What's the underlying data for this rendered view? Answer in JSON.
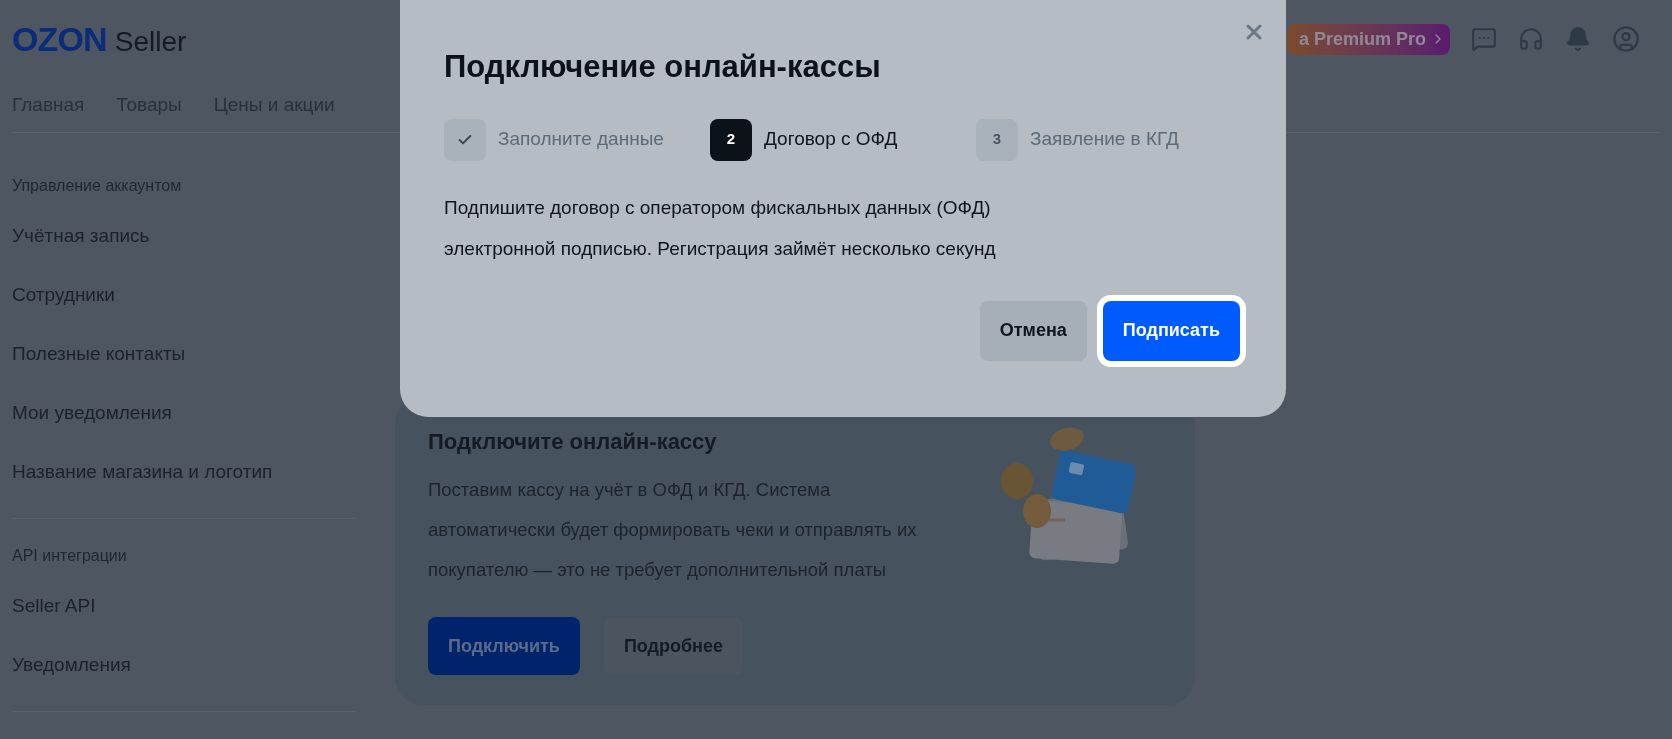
{
  "header": {
    "logo": "OZON",
    "logo_suffix": "Seller",
    "premium_badge": "а Premium Pro"
  },
  "nav": [
    "Главная",
    "Товары",
    "Цены и акции"
  ],
  "sidebar": [
    {
      "kind": "heading",
      "label": "Управление аккаунтом"
    },
    {
      "kind": "item",
      "label": "Учётная запись"
    },
    {
      "kind": "item",
      "label": "Сотрудники"
    },
    {
      "kind": "item",
      "label": "Полезные контакты"
    },
    {
      "kind": "item",
      "label": "Мои уведомления"
    },
    {
      "kind": "item",
      "label": "Название магазина и логотип"
    },
    {
      "kind": "divider"
    },
    {
      "kind": "heading",
      "label": "API интеграции"
    },
    {
      "kind": "item",
      "label": "Seller API"
    },
    {
      "kind": "item",
      "label": "Уведомления"
    },
    {
      "kind": "divider"
    }
  ],
  "card": {
    "title": "Подключите онлайн-кассу",
    "text": "Поставим кассу на учёт в ОФД и КГД. Система автоматически будет формировать чеки и отправлять их покупателю — это не требует дополнительной платы",
    "buttons": [
      {
        "kind": "primary",
        "label": "Подключить"
      },
      {
        "kind": "secondary",
        "label": "Подробнее"
      }
    ]
  },
  "modal": {
    "title": "Подключение онлайн-кассы",
    "steps": [
      {
        "done": true,
        "selected": false,
        "label": "Заполните данные"
      },
      {
        "done": false,
        "selected": true,
        "number": "2",
        "label": "Договор с ОФД"
      },
      {
        "done": false,
        "selected": false,
        "number": "3",
        "label": "Заявление в КГД"
      }
    ],
    "text": "Подпишите договор с оператором фискальных данных (ОФД) электронной подписью. Регистрация займёт несколько секунд",
    "buttons": [
      {
        "kind": "secondary",
        "label": "Отмена"
      },
      {
        "kind": "primary",
        "label": "Подписать"
      }
    ]
  }
}
